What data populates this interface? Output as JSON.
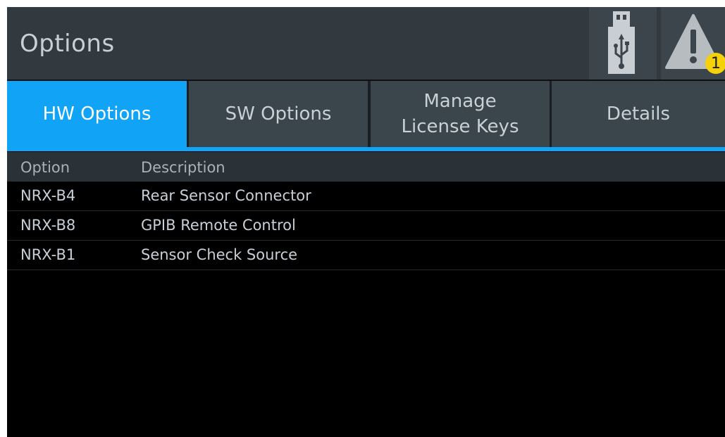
{
  "window": {
    "title": "Options"
  },
  "header_buttons": {
    "usb_icon": "usb-icon",
    "warning_icon": "warning-icon",
    "warning_count": "1",
    "warning_badge_color": "#f5d10a"
  },
  "tabs": [
    {
      "label": "HW Options",
      "active": true
    },
    {
      "label": "SW Options",
      "active": false
    },
    {
      "label": "Manage\nLicense Keys",
      "active": false
    },
    {
      "label": "Details",
      "active": false
    }
  ],
  "colors": {
    "accent": "#11a3f5",
    "header_bg": "#323a40",
    "tab_bg": "#3b454c",
    "content_bg": "#000000"
  },
  "table": {
    "columns": [
      "Option",
      "Description"
    ],
    "rows": [
      {
        "option": "NRX-B4",
        "description": "Rear Sensor Connector"
      },
      {
        "option": "NRX-B8",
        "description": "GPIB Remote Control"
      },
      {
        "option": "NRX-B1",
        "description": "Sensor Check Source"
      }
    ]
  }
}
